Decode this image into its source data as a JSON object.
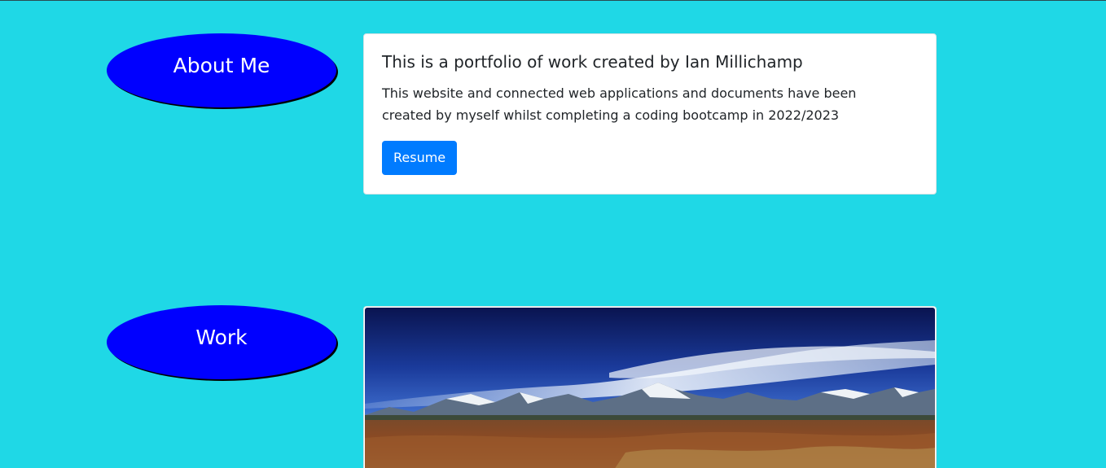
{
  "nav": {
    "about_label": "About Me",
    "work_label": "Work"
  },
  "about": {
    "title": "This is a portfolio of work created by Ian Millichamp",
    "text": "This website and connected web applications and documents have been created by myself whilst completing a coding bootcamp in 2022/2023",
    "button_label": "Resume"
  },
  "colors": {
    "background": "#1fd8e6",
    "pill": "#0000ff",
    "button": "#007bff"
  },
  "icons": {
    "work_image": "mountain-landscape-image"
  }
}
